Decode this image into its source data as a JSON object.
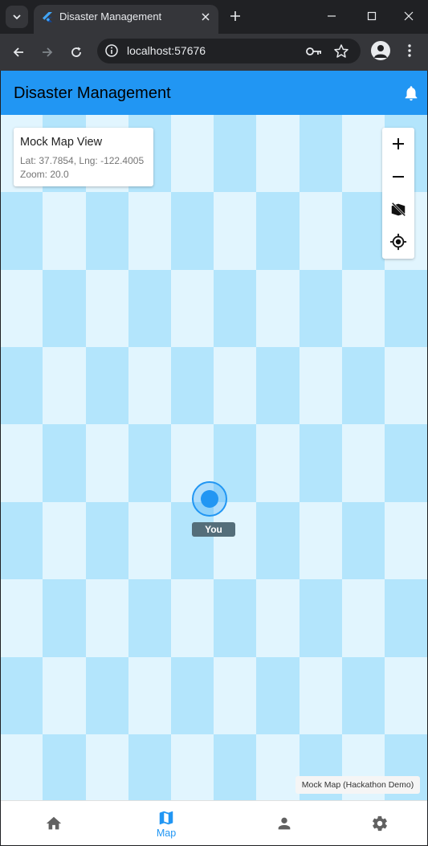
{
  "browser": {
    "tab_title": "Disaster Management",
    "url": "localhost:57676"
  },
  "app": {
    "title": "Disaster Management",
    "primary_color": "#2196f3"
  },
  "map": {
    "info_card": {
      "title": "Mock Map View",
      "coords": "Lat: 37.7854, Lng: -122.4005",
      "zoom": "Zoom: 20.0"
    },
    "controls": [
      "zoom-in-icon",
      "zoom-out-icon",
      "hide-layer-icon",
      "my-location-icon"
    ],
    "marker_label": "You",
    "attribution": "Mock Map (Hackathon Demo)",
    "tile_colors": {
      "light": "#e1f5fe",
      "dark": "#b3e5fc"
    }
  },
  "bottom_nav": {
    "items": [
      {
        "icon": "home-icon",
        "label": ""
      },
      {
        "icon": "map-icon",
        "label": "Map",
        "active": true
      },
      {
        "icon": "person-icon",
        "label": ""
      },
      {
        "icon": "settings-icon",
        "label": ""
      }
    ]
  }
}
